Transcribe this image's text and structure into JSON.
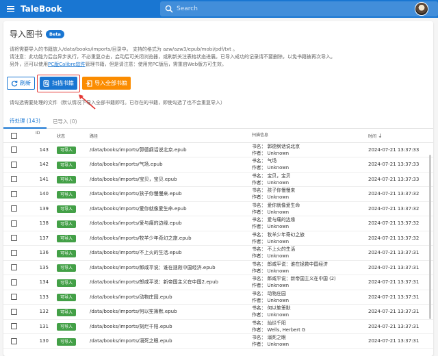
{
  "app": {
    "title": "TaleBook"
  },
  "search": {
    "placeholder": "Search"
  },
  "page": {
    "title": "导入图书",
    "badge": "Beta",
    "desc1": "请将需要导入的书籍放入/data/books/imports/目录中。 支持的格式为 azw/azw3/epub/mobi/pdf/txt 。",
    "desc2": "请注意：此功能为后台异步执行，不必重复点击，启动后可关闭浏览器，或刷新关注表格状态进展。已导入成功的记录请不要删除，以免书籍被再次导入。",
    "desc3_pre": "另外，还可以使用",
    "desc3_link": "PC版Calibre软件",
    "desc3_post": "管理书籍，但是请注意：使用完PC版后，需重启Web版方可生效。",
    "hint": "请勾选需要处理的文件（默认情况下导入全部书籍即可。已存在的书籍，即使勾选了也不会重复导入）"
  },
  "buttons": {
    "refresh": "刷新",
    "scan": "扫描书籍",
    "import_all": "导入全部书籍"
  },
  "tabs": {
    "pending": "待处理 (143)",
    "imported": "已导入 (0)"
  },
  "columns": {
    "id": "ID",
    "status": "状态",
    "path": "路径",
    "scan": "扫描信息",
    "time": "时间",
    "sort": "↓"
  },
  "rows": [
    {
      "id": "143",
      "status": "可导入",
      "path": "/data/books/imports/郭德纲话说北京.epub",
      "name": "书名：  郭德纲话说北京",
      "author": "作者：  Unknown",
      "time": "2024-07-21 13:37:33"
    },
    {
      "id": "142",
      "status": "可导入",
      "path": "/data/books/imports/气场.epub",
      "name": "书名：  气场",
      "author": "作者：  Unknown",
      "time": "2024-07-21 13:37:33"
    },
    {
      "id": "141",
      "status": "可导入",
      "path": "/data/books/imports/宝贝，宝贝.epub",
      "name": "书名：  宝贝，宝贝",
      "author": "作者：  Unknown",
      "time": "2024-07-21 13:37:33"
    },
    {
      "id": "140",
      "status": "可导入",
      "path": "/data/books/imports/孩子你慢慢来.epub",
      "name": "书名：  孩子你慢慢来",
      "author": "作者：  Unknown",
      "time": "2024-07-21 13:37:32"
    },
    {
      "id": "139",
      "status": "可导入",
      "path": "/data/books/imports/爱你就像爱生命.epub",
      "name": "书名：  爱你就像爱生命",
      "author": "作者：  Unknown",
      "time": "2024-07-21 13:37:32"
    },
    {
      "id": "138",
      "status": "可导入",
      "path": "/data/books/imports/爱与痛的边缘.epub",
      "name": "书名：  爱与痛的边缘",
      "author": "作者：  Unknown",
      "time": "2024-07-21 13:37:32"
    },
    {
      "id": "137",
      "status": "可导入",
      "path": "/data/books/imports/牧羊少年奇幻之旅.epub",
      "name": "书名：  牧羊少年奇幻之旅",
      "author": "作者：  Unknown",
      "time": "2024-07-21 13:37:32"
    },
    {
      "id": "136",
      "status": "可导入",
      "path": "/data/books/imports/不上火的生活.epub",
      "name": "书名：  不上火的生活",
      "author": "作者：  Unknown",
      "time": "2024-07-21 13:37:31"
    },
    {
      "id": "135",
      "status": "可导入",
      "path": "/data/books/imports/郎咸平说：谁在拯救中国经济.epub",
      "name": "书名：  郎咸平说：谁在拯救中国经济",
      "author": "作者：  Unknown",
      "time": "2024-07-21 13:37:31"
    },
    {
      "id": "134",
      "status": "可导入",
      "path": "/data/books/imports/郎咸平说：新帝国主义在中国2.epub",
      "name": "书名：  郎咸平说：新帝国主义在中国 (2)",
      "author": "作者：  Unknown",
      "time": "2024-07-21 13:37:31"
    },
    {
      "id": "133",
      "status": "可导入",
      "path": "/data/books/imports/动物庄园.epub",
      "name": "书名：  动物庄园",
      "author": "作者：  Unknown",
      "time": "2024-07-21 13:37:31"
    },
    {
      "id": "132",
      "status": "可导入",
      "path": "/data/books/imports/何以笙箫默.epub",
      "name": "书名：  何以笙箫默",
      "author": "作者：  Unknown",
      "time": "2024-07-21 13:37:31"
    },
    {
      "id": "131",
      "status": "可导入",
      "path": "/data/books/imports/刻烂千阳.epub",
      "name": "书名：  灿烂千阳",
      "author": "作者：  Wells, Herbert G",
      "time": "2024-07-21 13:37:31"
    },
    {
      "id": "130",
      "status": "可导入",
      "path": "/data/books/imports/溺死之眼.epub",
      "name": "书名：  溺死之眼",
      "author": "作者：  Unknown",
      "time": "2024-07-21 13:37:31"
    }
  ]
}
